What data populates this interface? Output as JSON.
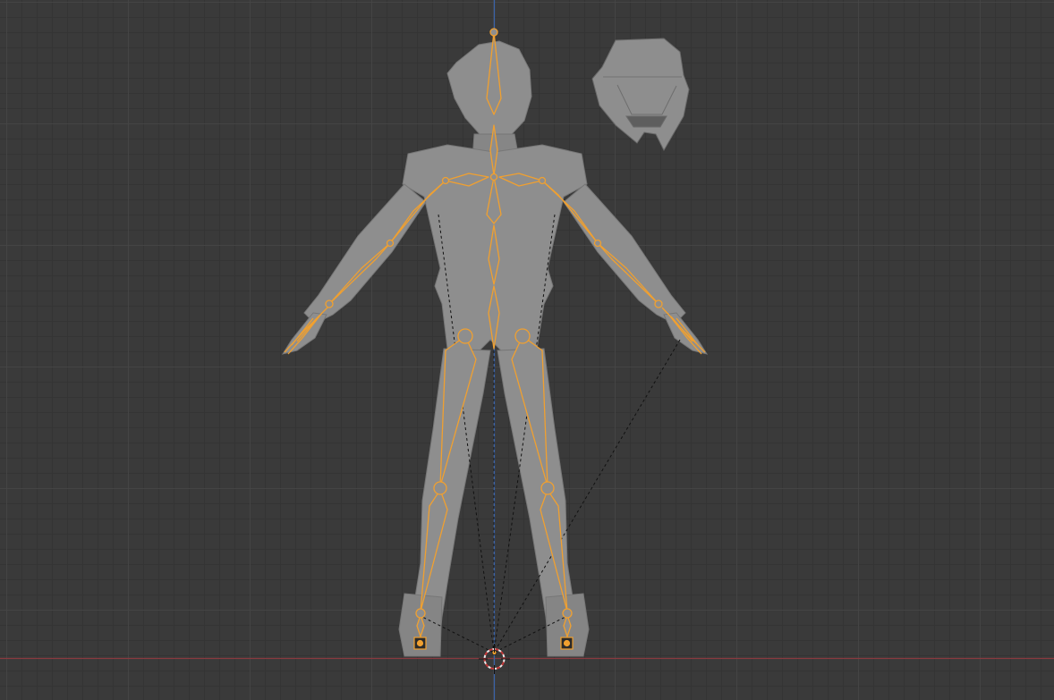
{
  "viewport": {
    "background": "#393939",
    "x_axis_color": "#8a3a40",
    "z_axis_color": "#3a63a8",
    "selection_color": "#f0a030",
    "mesh_color": "#8e8e8e"
  },
  "icons": {
    "cursor": "3d-cursor-icon",
    "origin": "object-origin-icon",
    "ik_target": "ik-target-icon"
  }
}
